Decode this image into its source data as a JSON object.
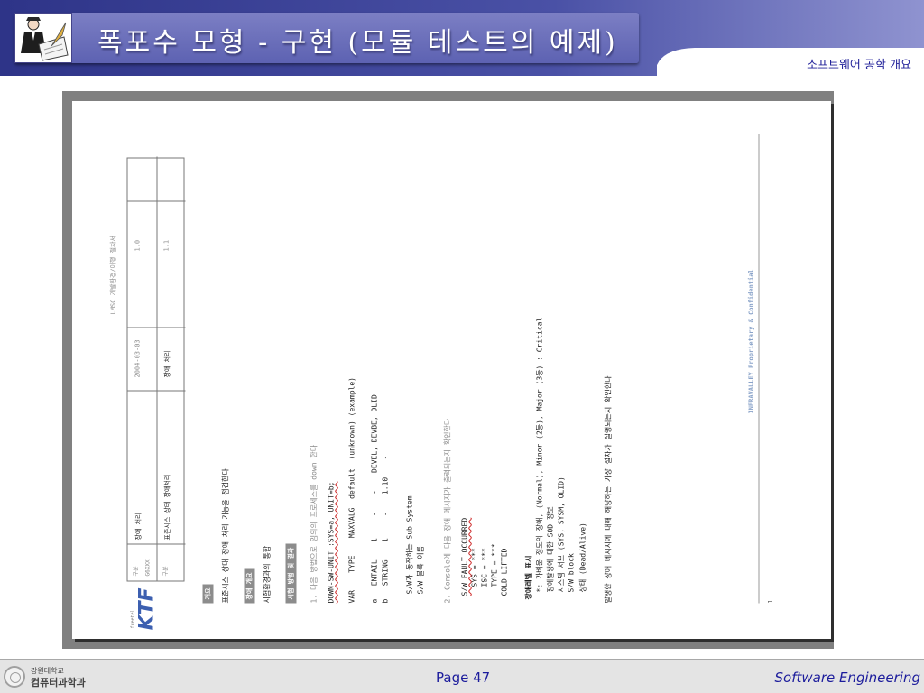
{
  "header": {
    "title": "폭포수 모형 - 구현 (모듈 테스트의 예제)",
    "subtitle": "소프트웨어 공학 개요",
    "colors": {
      "band": "#3d4497",
      "plate": "#6a6fbf",
      "wave": "#ffffff"
    },
    "logo_icon": "writer-with-quill-icon"
  },
  "document": {
    "brand": "KTF",
    "brand_small": "freetel",
    "doc_code": "LMSC 개발환경/이행 절차서",
    "table": {
      "row1": [
        "구분",
        "G6XXX",
        "담당부서",
        "장애 처리",
        "2004-03-03",
        "1.0"
      ],
      "row2": [
        "구분",
        "표준시스 상태 장애처리",
        "담당",
        "장애 처리",
        "1.1"
      ]
    },
    "section1": {
      "label": "개요",
      "text": "표준시스 상대 장애 처리 기능을 점검한다"
    },
    "section2": {
      "label": "장애 개요",
      "text": "시험환경과의 통합"
    },
    "section3": {
      "label": "시험 방법 및 결과"
    },
    "step1": "1. 다음 방법으로 임의의 프로세스를 down 한다",
    "cmd1": "DOWN-SW-UNIT :SYS=a, UNIT=b;",
    "table_head": [
      "VAR",
      "TYPE",
      "MAXVALG",
      "default",
      "(unknown)",
      "(example)"
    ],
    "table_row1": [
      "a",
      "ENTAIL",
      "1",
      "-",
      "-",
      "DEVEL, DEVBE, OLID"
    ],
    "table_row2": [
      "b",
      "STRING",
      "1",
      "-",
      "1.10",
      "-"
    ],
    "note1": "S/W가 동작하는 Sub System",
    "note2": "S/W 블록 이름",
    "step2": "2. Console에 다음 장애 메시지가 출력되는지 확인한다",
    "msg": [
      "S/W FAULT OCCURRED",
      "SYS = ***",
      "ISC = ***",
      "TYPE = ***",
      "COLD LIFTED"
    ],
    "explain_head": "장애레벨 표시",
    "explain1": "*: 가벼운 정도의 장애, (Normal), Minor (2등), Major (3등) : Critical",
    "explain2": "장애발생에 대한 SOD 정보",
    "explain3": "시스템 서브 (SYS, SYSM, OLID)",
    "explain4": "S/W block",
    "explain5": "상태 (Dead/Alive)",
    "final": "발생한 장애 메시지에 대해 해당하는 가장 절차가 실행되는지 확인한다",
    "footer_brand": "INFRAVALLEY Proprietary & Confidential",
    "page_no": "1"
  },
  "footer": {
    "school_small": "강원대학교",
    "school_dept": "컴퓨터과학과",
    "page_label": "Page 47",
    "course": "Software Engineering"
  }
}
